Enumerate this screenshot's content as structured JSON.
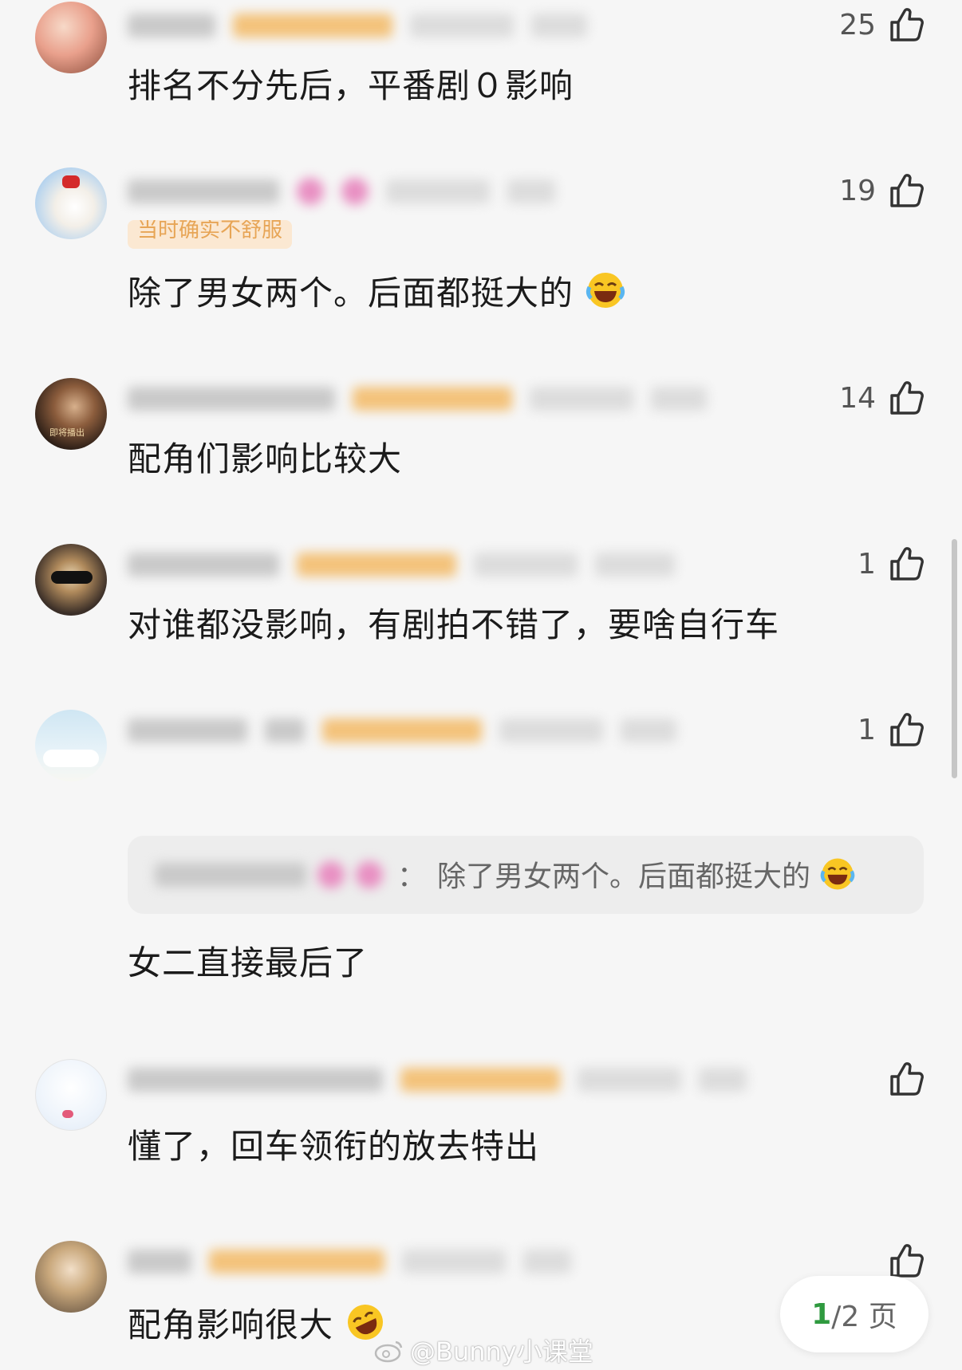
{
  "comments": [
    {
      "likes": "25",
      "text": "排名不分先后，平番剧０影响",
      "avatar_colors": [
        "#f6c9b2",
        "#d06a6a"
      ]
    },
    {
      "likes": "19",
      "tag": "当时确实不舒服",
      "text": "除了男女两个。后面都挺大的",
      "avatar_colors": [
        "#cfe3f5",
        "#f2f2f2"
      ]
    },
    {
      "likes": "14",
      "text": "配角们影响比较大",
      "avatar_colors": [
        "#3a2a22",
        "#c8a070"
      ],
      "avatar_caption": "即将播出"
    },
    {
      "likes": "1",
      "text": "对谁都没影响，有剧拍不错了，要啥自行车",
      "avatar_colors": [
        "#2f2a26",
        "#e0c9a0"
      ]
    },
    {
      "likes": "1",
      "quote": "除了男女两个。后面都挺大的",
      "quote_sep": "：",
      "text": "女二直接最后了",
      "avatar_colors": [
        "#d8ecf6",
        "#f8f8f8"
      ]
    },
    {
      "likes": "",
      "text": "懂了，回车领衔的放去特出",
      "avatar_colors": [
        "#eef4fb",
        "#ffffff"
      ]
    },
    {
      "likes": "",
      "text": "配角影响很大",
      "avatar_colors": [
        "#b89a70",
        "#f0e2cc"
      ]
    }
  ],
  "pager": {
    "current": "1",
    "total": "/2 页"
  },
  "watermark": "@Bunny小课堂",
  "icons": {
    "like": "thumbs-up-icon",
    "laugh": "laughing-emoji-icon",
    "rofl": "rofl-emoji-icon",
    "weibo": "weibo-logo-icon"
  }
}
